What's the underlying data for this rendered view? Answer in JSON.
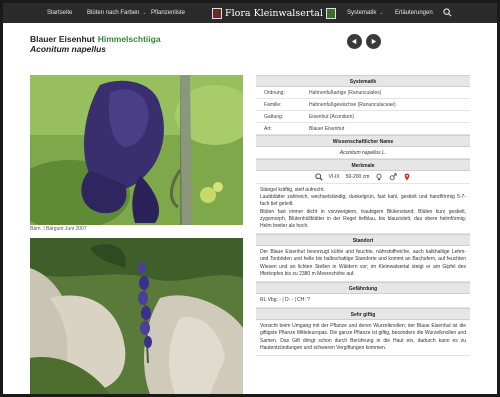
{
  "nav": {
    "items": [
      {
        "label": "Startseite"
      },
      {
        "label": "Blüten nach Farben"
      },
      {
        "label": "Pflanzenliste"
      },
      {
        "label": "Systematik"
      },
      {
        "label": "Erläuterungen"
      }
    ],
    "brand": "Flora Kleinwalsertal",
    "caret": "⌄"
  },
  "plant": {
    "name_de": "Blauer Eisenhut",
    "name_alt": "Himmelschtiiga",
    "name_lat": "Aconitum napellus"
  },
  "photos": {
    "caption": "Bärn. | Bärgunt Juni 2007"
  },
  "info": {
    "systematik": {
      "heading": "Systematik",
      "rows": [
        {
          "key": "Ordnung:",
          "value": "Hahnenfußartige (Ranunculales)"
        },
        {
          "key": "Familie:",
          "value": "Hahnenfußgewächse (Ranunculaceae)"
        },
        {
          "key": "Gattung:",
          "value": "Eisenhut (Aconitum)"
        },
        {
          "key": "Art:",
          "value": "Blauer Eisenhut"
        }
      ]
    },
    "wiss": {
      "heading": "Wissenschaftlicher Name",
      "value": "Aconitum napellus  L."
    },
    "merkmale": {
      "heading": "Merkmale",
      "months": "VI-IX",
      "height": "50-200 cm",
      "text": "Stängel kräftig, steif aufrecht.\nLaubblätter zahlreich, wechselständig, dunkelgrün, fast kahl, gestielt und handförmig 5-7-fach tief geteilt.\nBlüten fast immer dicht in vorzweigtem, traubigem Blütenstand; Blüten kurz gestielt, zygomorph, Blütenhüllblätter in der Regel tiefblau, bis blauviolett, das obere helmförmig; Helm breiter als hoch."
    },
    "standort": {
      "heading": "Standort",
      "text": "Der Blaue Eisenhut bevorzugt kühle und feuchte, nährstoffreiche, auch kalkhaltige Lehm- und Tonböden und helle bis halbschattige Standorte und kommt an Bachufern, auf feuchten Wiesen und an lichten Stellen in Wäldern vor; im Kleinwalsertal steigt er am Gipfel des Ifferkopfes bis zu 2380 m Meereshöhe auf."
    },
    "gefaehrdung": {
      "heading": "Gefährdung",
      "text": "RL Vbg: - | D: - | CH: ?"
    },
    "giftig": {
      "heading": "Sehr giftig",
      "text": "Vorsicht beim Umgang mit der Pflanze und deren Wurzelknollen; der Blaue Eisenhut ist die giftigste Pflanze Mitteleuropas. Die ganze Pflanze ist giftig, besonders die Wurzelknollen und Samen. Das Gift dringt schon durch Berührung in die Haut ein, dadurch kann es zu Hautentzündungen und schweren Vergiftungen kommen."
    }
  },
  "colors": {
    "nav_bg": "#2b2b2b",
    "accent_green": "#2e8b3a",
    "section_bg": "#e6e6e6",
    "flower": "#3a2f6e"
  },
  "icons": [
    "search-icon",
    "prev-arrow-icon",
    "next-arrow-icon",
    "magnifier-icon",
    "female-icon",
    "male-icon"
  ]
}
